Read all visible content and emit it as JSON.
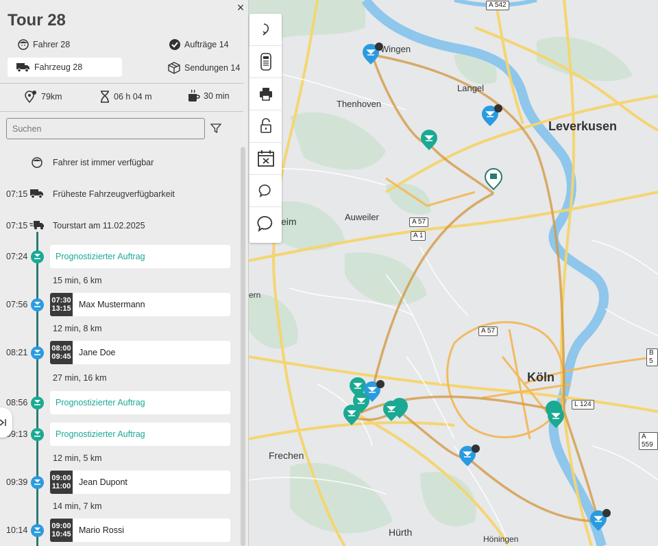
{
  "panel": {
    "title": "Tour 28",
    "driver": "Fahrer 28",
    "orders": "Aufträge 14",
    "vehicle": "Fahrzeug 28",
    "shipments": "Sendungen 14",
    "distance": "79km",
    "duration": "06 h 04 m",
    "break": "30 min",
    "search_placeholder": "Suchen",
    "close": "×"
  },
  "timeline": {
    "driver_available": "Fahrer ist immer verfügbar",
    "vehicle_time": "07:15",
    "vehicle_label": "Früheste Fahrzeugverfügbarkeit",
    "tourstart_time": "07:15",
    "tourstart_label": "Tourstart am 11.02.2025",
    "stops": [
      {
        "time": "07:24",
        "label": "Prognostizierter Auftrag"
      },
      {
        "drive": "15 min, 6 km"
      },
      {
        "time": "07:56",
        "tw_from": "07:30",
        "tw_to": "13:15",
        "name": "Max Mustermann"
      },
      {
        "drive": "12 min, 8 km"
      },
      {
        "time": "08:21",
        "tw_from": "08:00",
        "tw_to": "09:45",
        "name": "Jane Doe"
      },
      {
        "drive": "27 min, 16 km"
      },
      {
        "time": "08:56",
        "label": "Prognostizierter Auftrag"
      },
      {
        "time": "09:13",
        "label": "Prognostizierter Auftrag"
      },
      {
        "drive": "12 min, 5 km"
      },
      {
        "time": "09:39",
        "tw_from": "09:00",
        "tw_to": "11:00",
        "name": "Jean Dupont"
      },
      {
        "drive": "14 min, 7 km"
      },
      {
        "time": "10:14",
        "tw_from": "09:00",
        "tw_to": "10:45",
        "name": "Mario Rossi"
      }
    ]
  },
  "map": {
    "places": [
      "Leverkusen",
      "Köln",
      "Langel",
      "Thenhoven",
      "Auweiler",
      "Frechen",
      "Hürth",
      "Höningen",
      "Wingen",
      "eim",
      "ern"
    ],
    "roads": [
      "A 542",
      "A 57",
      "A 1",
      "A 57",
      "L 124",
      "B 5",
      "A 559"
    ]
  },
  "colors": {
    "teal": "#1aa993",
    "blue": "#2a9be0",
    "route": "#d4953a"
  }
}
